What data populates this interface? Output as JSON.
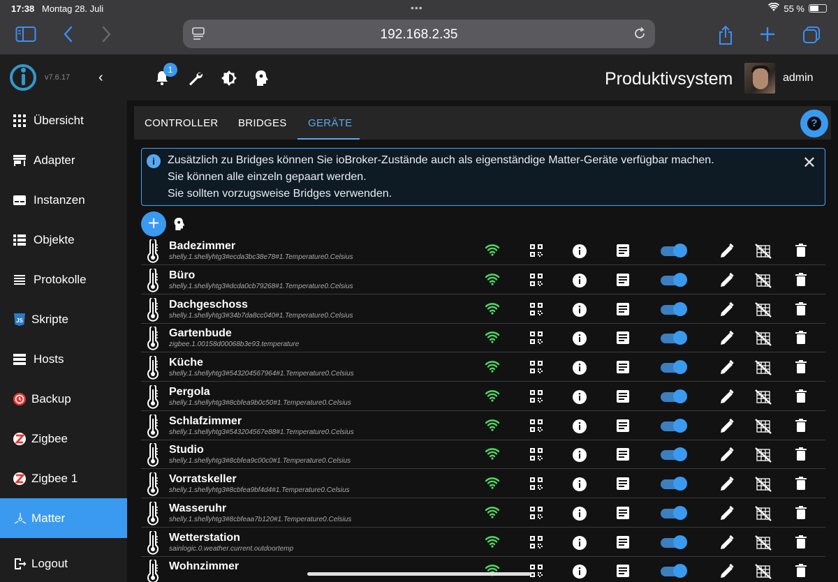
{
  "status_bar": {
    "time": "17:38",
    "date": "Montag 28. Juli",
    "battery": "55 %"
  },
  "browser": {
    "url": "192.168.2.35"
  },
  "sidebar": {
    "version": "v7.6.17",
    "items": [
      {
        "label": "Übersicht",
        "icon": "grid-icon"
      },
      {
        "label": "Adapter",
        "icon": "store-icon"
      },
      {
        "label": "Instanzen",
        "icon": "instances-icon"
      },
      {
        "label": "Objekte",
        "icon": "list-icon"
      },
      {
        "label": "Protokolle",
        "icon": "log-icon"
      },
      {
        "label": "Skripte",
        "icon": "js-icon"
      },
      {
        "label": "Hosts",
        "icon": "storage-icon"
      },
      {
        "label": "Backup",
        "icon": "backup-icon"
      },
      {
        "label": "Zigbee",
        "icon": "zigbee-icon"
      },
      {
        "label": "Zigbee 1",
        "icon": "zigbee-icon"
      },
      {
        "label": "Matter",
        "icon": "matter-icon"
      },
      {
        "label": "Logout",
        "icon": "logout-icon"
      }
    ]
  },
  "header": {
    "notification_count": "1",
    "system_name": "Produktivsystem",
    "username": "admin"
  },
  "tabs": [
    {
      "label": "CONTROLLER"
    },
    {
      "label": "BRIDGES"
    },
    {
      "label": "GERÄTE"
    }
  ],
  "info": {
    "line1": "Zusätzlich zu Bridges können Sie ioBroker-Zustände auch als eigenständige Matter-Geräte verfügbar machen.",
    "line2": "Sie können alle einzeln gepaart werden.",
    "line3": "Sie sollten vorzugsweise Bridges verwenden."
  },
  "devices": [
    {
      "name": "Badezimmer",
      "id": "shelly.1.shellyhtg3#ecda3bc38e78#1.Temperature0.Celsius",
      "enabled": true
    },
    {
      "name": "Büro",
      "id": "shelly.1.shellyhtg3#dcda0cb79268#1.Temperature0.Celsius",
      "enabled": true
    },
    {
      "name": "Dachgeschoss",
      "id": "shelly.1.shellyhtg3#34b7da8cc040#1.Temperature0.Celsius",
      "enabled": true
    },
    {
      "name": "Gartenbude",
      "id": "zigbee.1.00158d00068b3e93.temperature",
      "enabled": true
    },
    {
      "name": "Küche",
      "id": "shelly.1.shellyhtg3#543204567964#1.Temperature0.Celsius",
      "enabled": true
    },
    {
      "name": "Pergola",
      "id": "shelly.1.shellyhtg3#8cbfea9b0c50#1.Temperature0.Celsius",
      "enabled": true
    },
    {
      "name": "Schlafzimmer",
      "id": "shelly.1.shellyhtg3#543204567e88#1.Temperature0.Celsius",
      "enabled": true
    },
    {
      "name": "Studio",
      "id": "shelly.1.shellyhtg3#8cbfea9c00c0#1.Temperature0.Celsius",
      "enabled": true
    },
    {
      "name": "Vorratskeller",
      "id": "shelly.1.shellyhtg3#8cbfea9bf4d4#1.Temperature0.Celsius",
      "enabled": true
    },
    {
      "name": "Wasseruhr",
      "id": "shelly.1.shellyhtg3#8cbfeaa7b120#1.Temperature0.Celsius",
      "enabled": true
    },
    {
      "name": "Wetterstation",
      "id": "sainlogic.0.weather.current.outdoortemp",
      "enabled": true
    },
    {
      "name": "Wohnzimmer",
      "id": "",
      "enabled": true
    }
  ],
  "colors": {
    "accent": "#3a9af0",
    "wifi_ok": "#4cd964",
    "sidebar_bg": "#1e1e1e",
    "page_bg": "#121212"
  }
}
